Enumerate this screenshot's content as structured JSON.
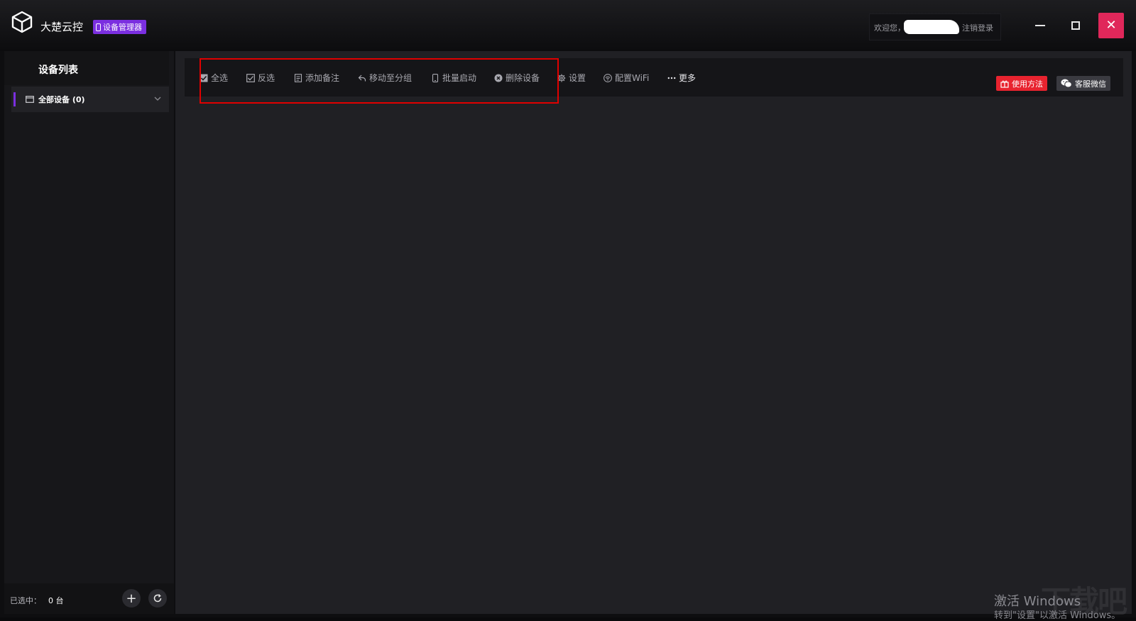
{
  "app": {
    "name": "大楚云控",
    "badge": "设备管理器"
  },
  "user": {
    "welcome": "欢迎您，",
    "logout": "注销登录"
  },
  "sidebar": {
    "title": "设备列表",
    "groups": [
      {
        "label": "全部设备 (0)"
      }
    ],
    "footer": {
      "selected_label": "已选中：",
      "selected_count": "0 台"
    }
  },
  "toolbar": {
    "items": [
      {
        "label": "全选",
        "icon": "checkbox-filled-icon"
      },
      {
        "label": "反选",
        "icon": "checkbox-outline-icon"
      },
      {
        "label": "添加备注",
        "icon": "note-icon"
      },
      {
        "label": "移动至分组",
        "icon": "move-arrow-icon"
      },
      {
        "label": "批量启动",
        "icon": "phone-icon"
      },
      {
        "label": "删除设备",
        "icon": "delete-circle-icon"
      },
      {
        "label": "设置",
        "icon": "gear-icon"
      },
      {
        "label": "配置WiFi",
        "icon": "wifi-icon"
      },
      {
        "label": "更多",
        "icon": "more-dots-icon"
      }
    ],
    "help_button": "使用方法",
    "wechat_button": "客服微信"
  },
  "watermark": {
    "line1": "激活 Windows",
    "line2": "转到\"设置\"以激活 Windows。",
    "logo": "下载吧"
  },
  "colors": {
    "accent_purple": "#7b2fe0",
    "close_red": "#e0275a",
    "help_red": "#e8232f"
  }
}
